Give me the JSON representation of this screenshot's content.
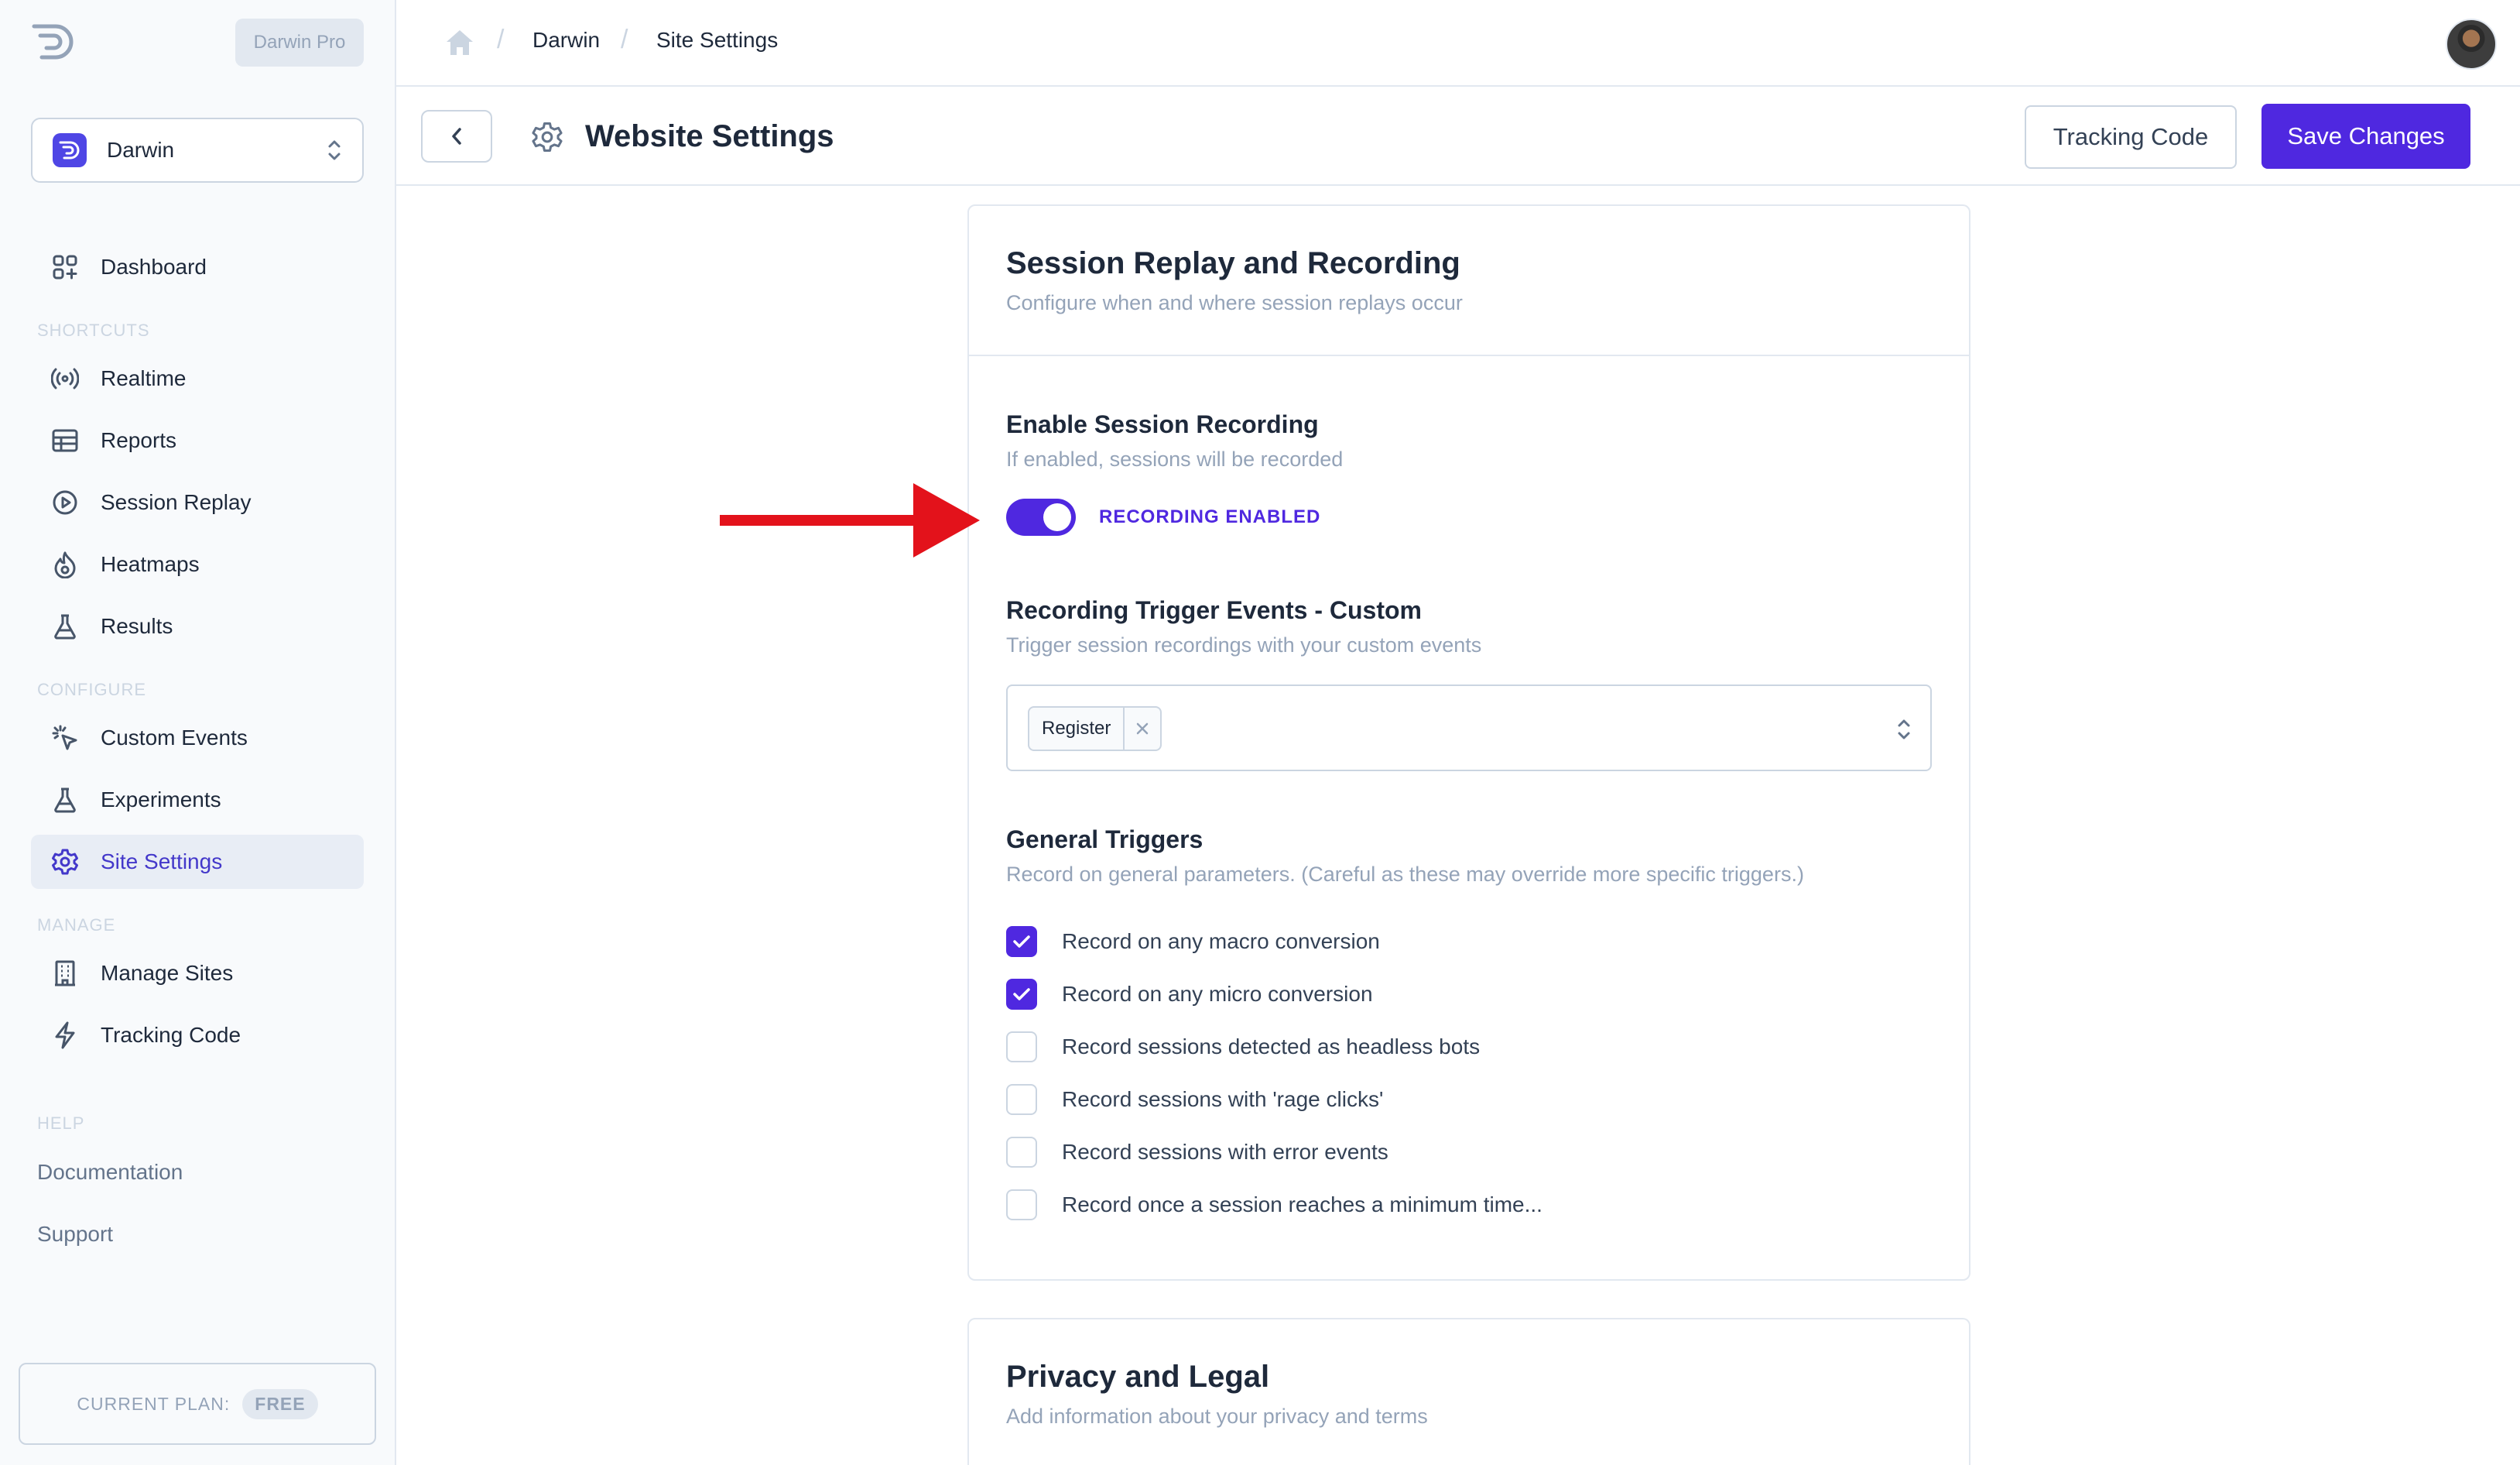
{
  "sidebar": {
    "plan_pill": "Darwin Pro",
    "site_selector": {
      "name": "Darwin"
    },
    "nav": {
      "dashboard": "Dashboard",
      "shortcuts_heading": "SHORTCUTS",
      "realtime": "Realtime",
      "reports": "Reports",
      "session_replay": "Session Replay",
      "heatmaps": "Heatmaps",
      "results": "Results",
      "configure_heading": "CONFIGURE",
      "custom_events": "Custom Events",
      "experiments": "Experiments",
      "site_settings": "Site Settings",
      "manage_heading": "MANAGE",
      "manage_sites": "Manage Sites",
      "tracking_code": "Tracking Code",
      "help_heading": "HELP",
      "documentation": "Documentation",
      "support": "Support"
    },
    "current_plan": {
      "label": "CURRENT PLAN:",
      "value": "FREE"
    }
  },
  "topbar": {
    "breadcrumb": [
      "Darwin",
      "Site Settings"
    ]
  },
  "header": {
    "title": "Website Settings",
    "tracking_code_button": "Tracking Code",
    "save_button": "Save Changes"
  },
  "session_card": {
    "title": "Session Replay and Recording",
    "subtitle": "Configure when and where session replays occur",
    "enable": {
      "title": "Enable Session Recording",
      "subtitle": "If enabled, sessions will be recorded",
      "toggle_on": true,
      "toggle_label": "RECORDING ENABLED"
    },
    "custom_trigger": {
      "title": "Recording Trigger Events - Custom",
      "subtitle": "Trigger session recordings with your custom events",
      "selected": [
        "Register"
      ]
    },
    "general": {
      "title": "General Triggers",
      "subtitle": "Record on general parameters. (Careful as these may override more specific triggers.)",
      "options": [
        {
          "label": "Record on any macro conversion",
          "checked": true
        },
        {
          "label": "Record on any micro conversion",
          "checked": true
        },
        {
          "label": "Record sessions detected as headless bots",
          "checked": false
        },
        {
          "label": "Record sessions with 'rage clicks'",
          "checked": false
        },
        {
          "label": "Record sessions with error events",
          "checked": false
        },
        {
          "label": "Record once a session reaches a minimum time...",
          "checked": false
        }
      ]
    }
  },
  "privacy_card": {
    "title": "Privacy and Legal",
    "subtitle": "Add information about your privacy and terms"
  },
  "colors": {
    "accent": "#4f28e0",
    "annotation_arrow": "#e3121b"
  }
}
